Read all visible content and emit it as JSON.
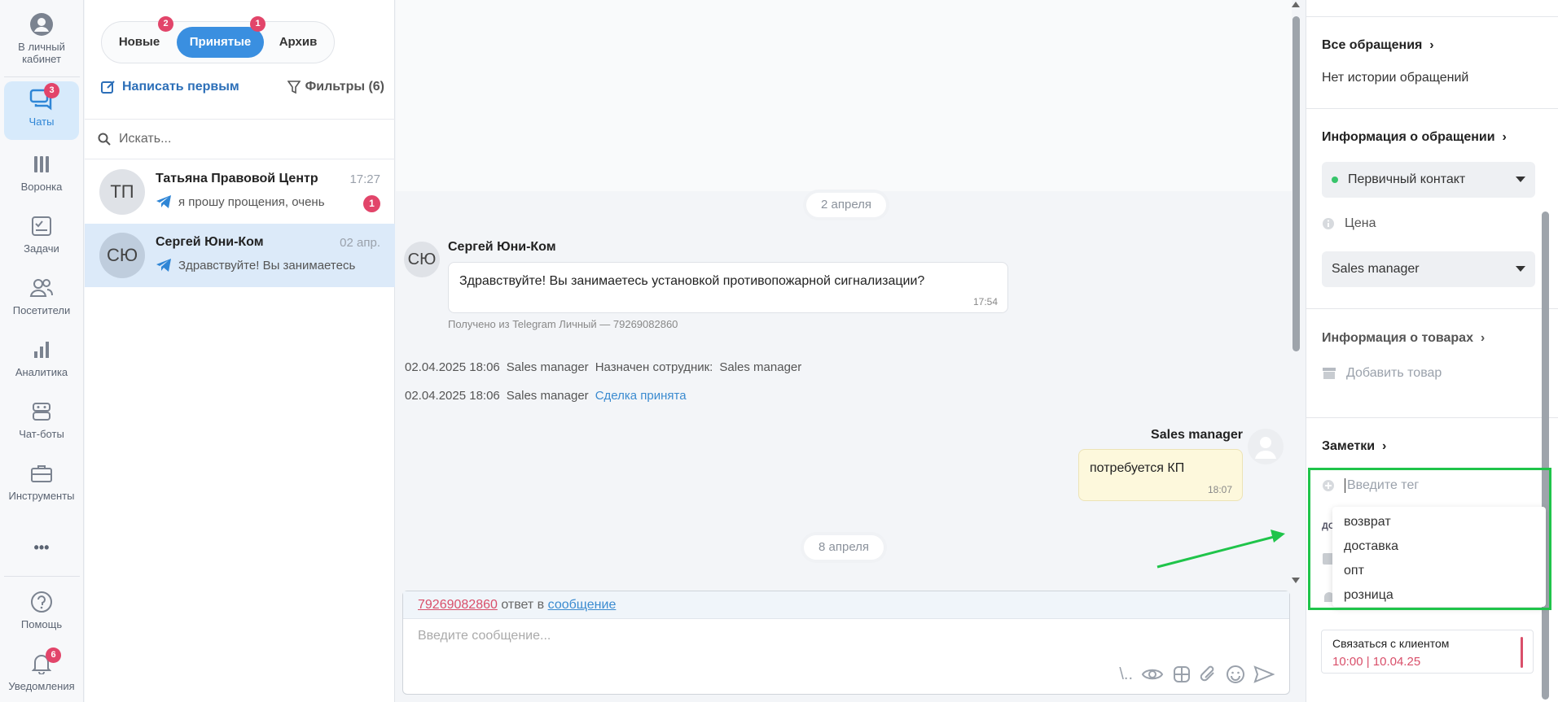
{
  "nav": {
    "items": [
      {
        "label": "В личный кабинет",
        "icon": "user-icon"
      },
      {
        "label": "Чаты",
        "icon": "chats-icon",
        "badge": "3"
      },
      {
        "label": "Воронка",
        "icon": "funnel-icon"
      },
      {
        "label": "Задачи",
        "icon": "tasks-icon"
      },
      {
        "label": "Посетители",
        "icon": "visitors-icon"
      },
      {
        "label": "Аналитика",
        "icon": "analytics-icon"
      },
      {
        "label": "Чат-боты",
        "icon": "chatbot-icon"
      },
      {
        "label": "Инструменты",
        "icon": "toolbox-icon"
      },
      {
        "label": "•••",
        "icon": "more-icon"
      },
      {
        "label": "Помощь",
        "icon": "help-icon"
      },
      {
        "label": "Уведомления",
        "icon": "bell-icon",
        "badge": "6"
      }
    ]
  },
  "list": {
    "tabs": [
      {
        "label": "Новые",
        "badge": "2"
      },
      {
        "label": "Принятые",
        "badge": "1"
      },
      {
        "label": "Архив"
      }
    ],
    "write_first": "Написать первым",
    "filters": "Фильтры (6)",
    "search_placeholder": "Искать...",
    "chats": [
      {
        "initials": "ТП",
        "name": "Татьяна Правовой Центр",
        "time": "17:27",
        "preview": "я прошу прощения, очень",
        "unread": "1"
      },
      {
        "initials": "СЮ",
        "name": "Сергей Юни-Ком",
        "time": "02 апр.",
        "preview": "Здравствуйте! Вы занимаетесь"
      }
    ]
  },
  "chat": {
    "date1": "2 апреля",
    "msg_avatar": "СЮ",
    "author": "Сергей Юни-Ком",
    "incoming_text": "Здравствуйте! Вы занимаетесь установкой противопожарной сигнализации?",
    "incoming_time": "17:54",
    "source": "Получено из Telegram Личный — 79269082860",
    "sys1": {
      "date": "02.04.2025 18:06",
      "who": "Sales manager",
      "text": "Назначен сотрудник:",
      "value": "Sales manager"
    },
    "sys2": {
      "date": "02.04.2025 18:06",
      "who": "Sales manager",
      "link": "Сделка принята"
    },
    "out_author": "Sales manager",
    "outgoing_text": "потребуется КП",
    "outgoing_time": "18:07",
    "date2": "8 апреля",
    "reply_number": "79269082860",
    "reply_mid": "ответ в",
    "reply_link": "сообщение",
    "input_placeholder": "Введите сообщение..."
  },
  "panel": {
    "all_requests": "Все обращения",
    "no_history": "Нет истории обращений",
    "request_info": "Информация о обращении",
    "status": "Первичный контакт",
    "price": "Цена",
    "manager": "Sales manager",
    "goods_info": "Информация о товарах",
    "add_goods": "Добавить товар",
    "notes": "Заметки",
    "tag_placeholder": "Введите тег",
    "tags": [
      "возврат",
      "доставка",
      "опт",
      "розница"
    ],
    "hidden_label": "ДО",
    "task_title": "Связаться с клиентом",
    "task_due": "10:00 | 10.04.25"
  },
  "colors": {
    "accent": "#3a8fe0",
    "badge": "#e2456a",
    "highlight": "#1fc44a"
  }
}
